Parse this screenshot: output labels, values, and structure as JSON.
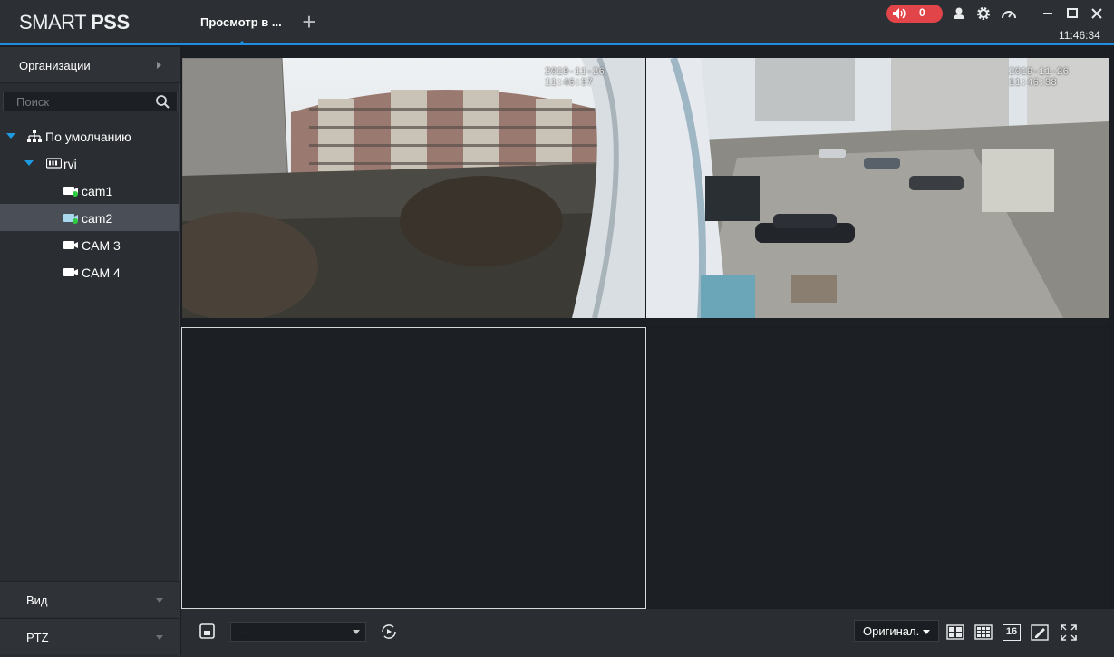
{
  "app": {
    "logo_light": "SMART",
    "logo_bold": "PSS"
  },
  "tabs": [
    {
      "label": "Просмотр в ..."
    }
  ],
  "titlebar": {
    "alarm_count": "0",
    "clock": "11:46:34"
  },
  "sidebar": {
    "org_label": "Организации",
    "search_placeholder": "Поиск",
    "tree": {
      "root": "По умолчанию",
      "device": "rvi",
      "cameras": [
        {
          "label": "cam1",
          "online": true
        },
        {
          "label": "cam2",
          "online": true,
          "selected": true
        },
        {
          "label": "CAM 3",
          "online": false
        },
        {
          "label": "CAM 4",
          "online": false
        }
      ]
    },
    "view_label": "Вид",
    "ptz_label": "PTZ"
  },
  "video": {
    "cam1_timestamp": "2019-11-26 11:46:37",
    "cam2_timestamp": "2019-11-26 11:46:38"
  },
  "bottombar": {
    "preset_value": "--",
    "stream_mode": "Оригинал.",
    "layout_16_label": "16"
  },
  "colors": {
    "accent": "#1e8fe0",
    "alarm": "#e24549",
    "online": "#2ecc40"
  }
}
